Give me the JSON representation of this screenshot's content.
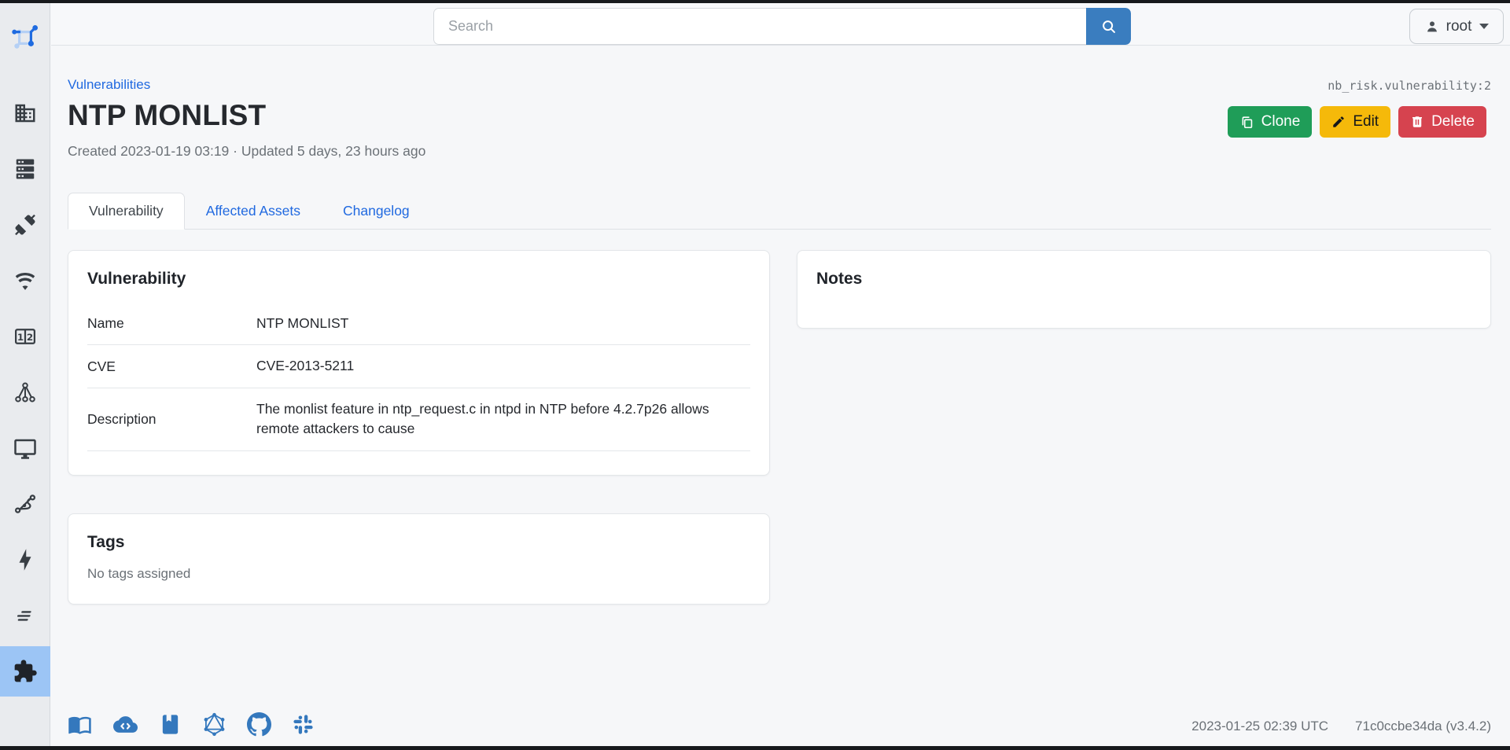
{
  "topbar": {
    "search_placeholder": "Search",
    "user_label": "root"
  },
  "page": {
    "breadcrumb": "Vulnerabilities",
    "title": "NTP MONLIST",
    "object_id": "nb_risk.vulnerability:2",
    "meta": "Created 2023-01-19 03:19 · Updated 5 days, 23 hours ago",
    "actions": {
      "clone": "Clone",
      "edit": "Edit",
      "delete": "Delete"
    }
  },
  "tabs": [
    {
      "label": "Vulnerability",
      "active": true
    },
    {
      "label": "Affected Assets",
      "active": false
    },
    {
      "label": "Changelog",
      "active": false
    }
  ],
  "vulnerability_card": {
    "title": "Vulnerability",
    "rows": [
      {
        "label": "Name",
        "value": "NTP MONLIST"
      },
      {
        "label": "CVE",
        "value": "CVE-2013-5211"
      },
      {
        "label": "Description",
        "value": "The monlist feature in ntp_request.c in ntpd in NTP before 4.2.7p26 allows remote attackers to cause"
      }
    ]
  },
  "notes_card": {
    "title": "Notes"
  },
  "tags_card": {
    "title": "Tags",
    "empty_text": "No tags assigned"
  },
  "sidebar": {
    "icons": [
      "netbox-logo",
      "organization-icon",
      "devices-icon",
      "connections-icon",
      "wireless-icon",
      "ipam-icon",
      "overlay-icon",
      "virtualization-icon",
      "circuits-icon",
      "power-icon",
      "logging-icon",
      "plugins-icon"
    ],
    "active_item": "plugins-icon"
  },
  "footer": {
    "icons": [
      "docs-icon",
      "rest-api-icon",
      "api-docs-icon",
      "graphql-icon",
      "github-icon",
      "community-icon"
    ],
    "timestamp": "2023-01-25 02:39 UTC",
    "build": "71c0ccbe34da (v3.4.2)"
  },
  "colors": {
    "link_blue": "#2069e0",
    "search_button_blue": "#3a7dbf",
    "clone_green": "#1f9d58",
    "edit_yellow": "#f5b90a",
    "delete_red": "#d6434f",
    "sidebar_active_blue": "#9cc5f5",
    "footer_icon_blue": "#3478bd"
  }
}
